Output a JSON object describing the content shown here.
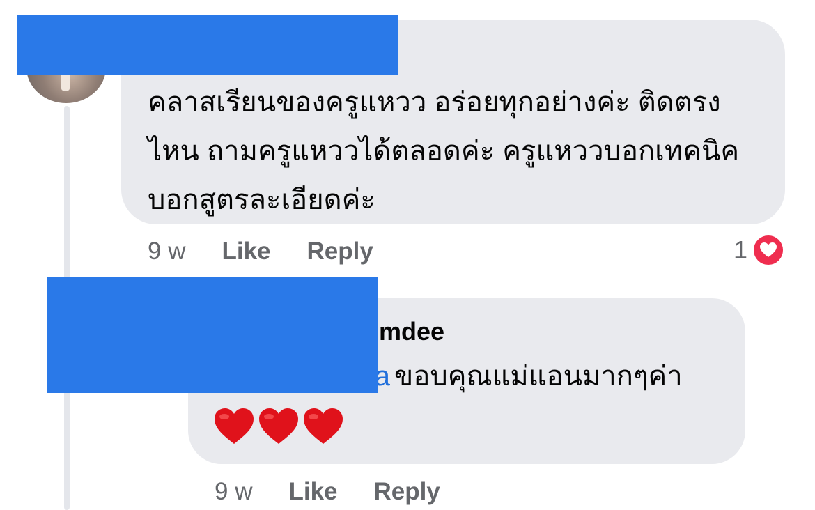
{
  "comment": {
    "text": "คลาสเรียนของครูแหวว อร่อยทุกอย่างค่ะ ติดตรงไหน ถามครูแหววได้ตลอดค่ะ ครูแหววบอกเทคนิคบอกสูตรละเอียดค่ะ",
    "time": "9 w",
    "like_label": "Like",
    "reply_label": "Reply",
    "reaction_count": "1",
    "reaction_icon": "heart-icon",
    "reaction_color": "#ef2d4f"
  },
  "reply": {
    "author_visible": "mdee",
    "mention_visible": "a",
    "text": "ขอบคุณแม่แอนมากๆค่า",
    "emoji": "❤️❤️❤️",
    "time": "9 w",
    "like_label": "Like",
    "reply_label": "Reply"
  },
  "colors": {
    "bubble": "#e9eaee",
    "meta_text": "#65676b",
    "mention": "#216fdb",
    "redaction": "#2a79e8"
  }
}
